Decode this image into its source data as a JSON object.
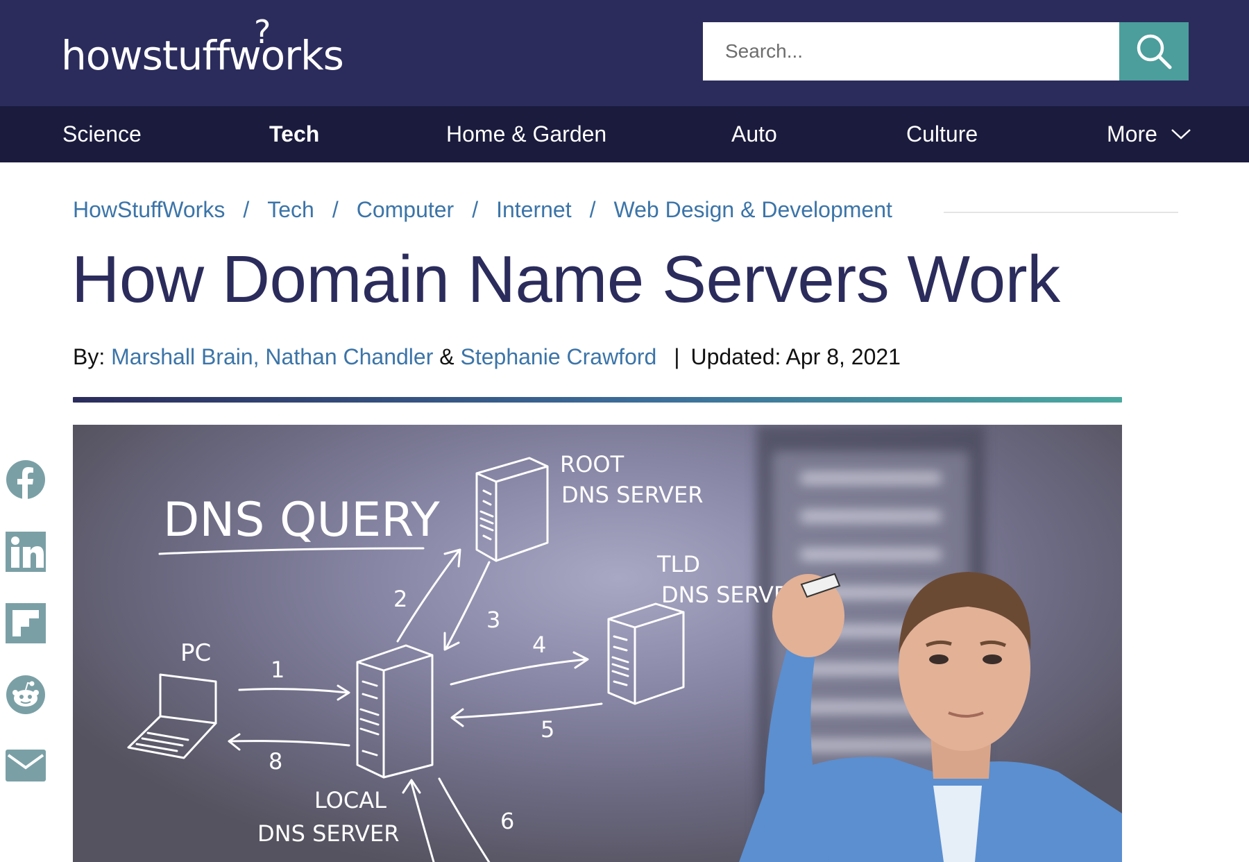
{
  "header": {
    "logo_text": "howstuffworks",
    "search": {
      "placeholder": "Search..."
    },
    "search_button_icon": "search-icon"
  },
  "nav": {
    "items": [
      {
        "label": "Science"
      },
      {
        "label": "Tech",
        "active": true
      },
      {
        "label": "Home & Garden"
      },
      {
        "label": "Auto"
      },
      {
        "label": "Culture"
      },
      {
        "label": "More",
        "icon": "chevron-down-icon"
      }
    ]
  },
  "breadcrumb": [
    "HowStuffWorks",
    "Tech",
    "Computer",
    "Internet",
    "Web Design & Development"
  ],
  "breadcrumb_separator": "/",
  "article": {
    "title": "How Domain Name Servers Work",
    "byline_prefix": "By:",
    "authors_1": "Marshall Brain, Nathan Chandler",
    "ampersand": "&",
    "authors_2": "Stephanie Crawford",
    "separator": "|",
    "updated": "Updated: Apr 8, 2021"
  },
  "hero_image": {
    "texts": {
      "heading": "DNS QUERY",
      "root_1": "ROOT",
      "root_2": "DNS SERVER",
      "tld_1": "TLD",
      "tld_2": "DNS SERVER",
      "pc": "PC",
      "local_1": "LOCAL",
      "local_2": "DNS SERVER"
    },
    "step_numbers": [
      "1",
      "2",
      "3",
      "4",
      "5",
      "6",
      "8"
    ]
  },
  "share": [
    {
      "icon": "facebook-icon"
    },
    {
      "icon": "linkedin-icon"
    },
    {
      "icon": "flipboard-icon"
    },
    {
      "icon": "reddit-icon"
    },
    {
      "icon": "email-icon"
    }
  ],
  "colors": {
    "header_bg": "#2b2c5c",
    "nav_bg": "#1a1b3d",
    "accent_teal": "#4b9e9c",
    "link_blue": "#3b74a8",
    "title": "#2b2c5c",
    "share_icon": "#7aa0a6"
  }
}
